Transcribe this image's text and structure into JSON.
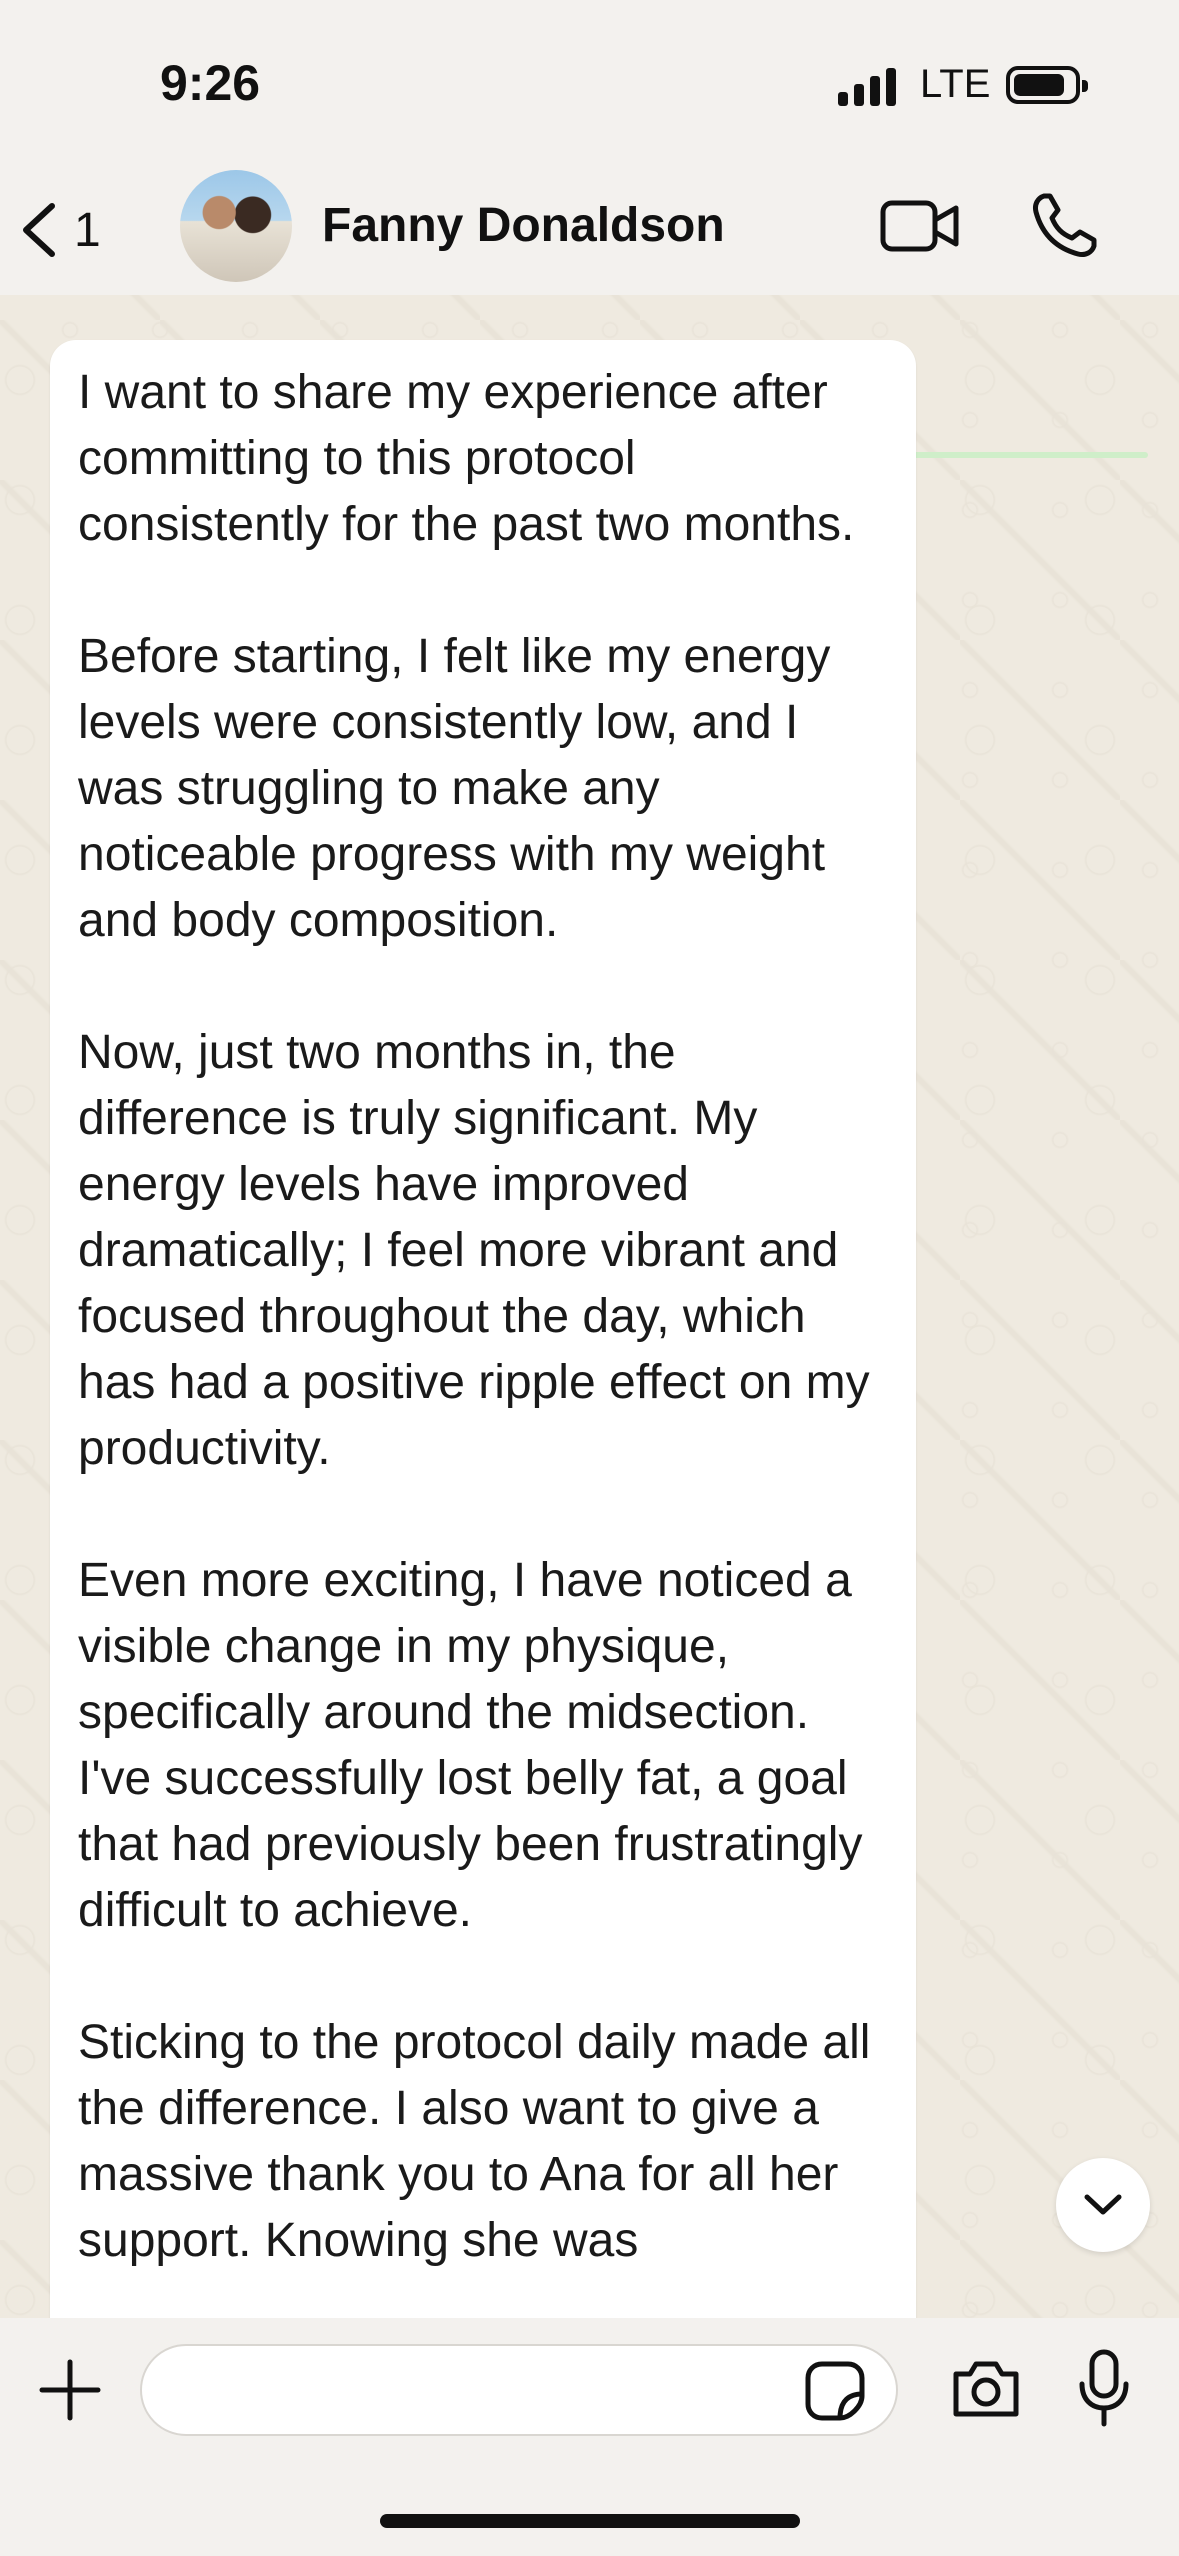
{
  "status_bar": {
    "time": "9:26",
    "network": "LTE"
  },
  "header": {
    "back_count": "1",
    "contact_name": "Fanny Donaldson",
    "icons": [
      "chevron-left-icon",
      "video-camera-icon",
      "phone-icon"
    ]
  },
  "message": {
    "paragraphs": [
      "I want to share my experience after committing to this protocol consistently for the past two months.",
      "Before starting, I felt like my energy levels were consistently low, and I was struggling to make any noticeable progress with my weight and body composition.",
      "Now, just two months in, the difference is truly significant. My energy levels have improved dramatically; I feel more vibrant and focused throughout the day, which has had a positive ripple effect on my productivity.",
      "Even more exciting, I have noticed a visible change in my physique, specifically around the midsection. I've successfully lost belly fat, a goal that had previously been frustratingly difficult to achieve.",
      "Sticking to the protocol daily made all the difference. I also want to give a massive thank you to Ana for all her support. Knowing she was"
    ]
  },
  "input_bar": {
    "input_value": "",
    "icons": [
      "plus-icon",
      "sticker-icon",
      "camera-icon",
      "microphone-icon"
    ]
  },
  "colors": {
    "background": "#efeae0",
    "bubble": "#ffffff",
    "bars": "#f3f1ee",
    "header_accent": "#cfeec9"
  }
}
